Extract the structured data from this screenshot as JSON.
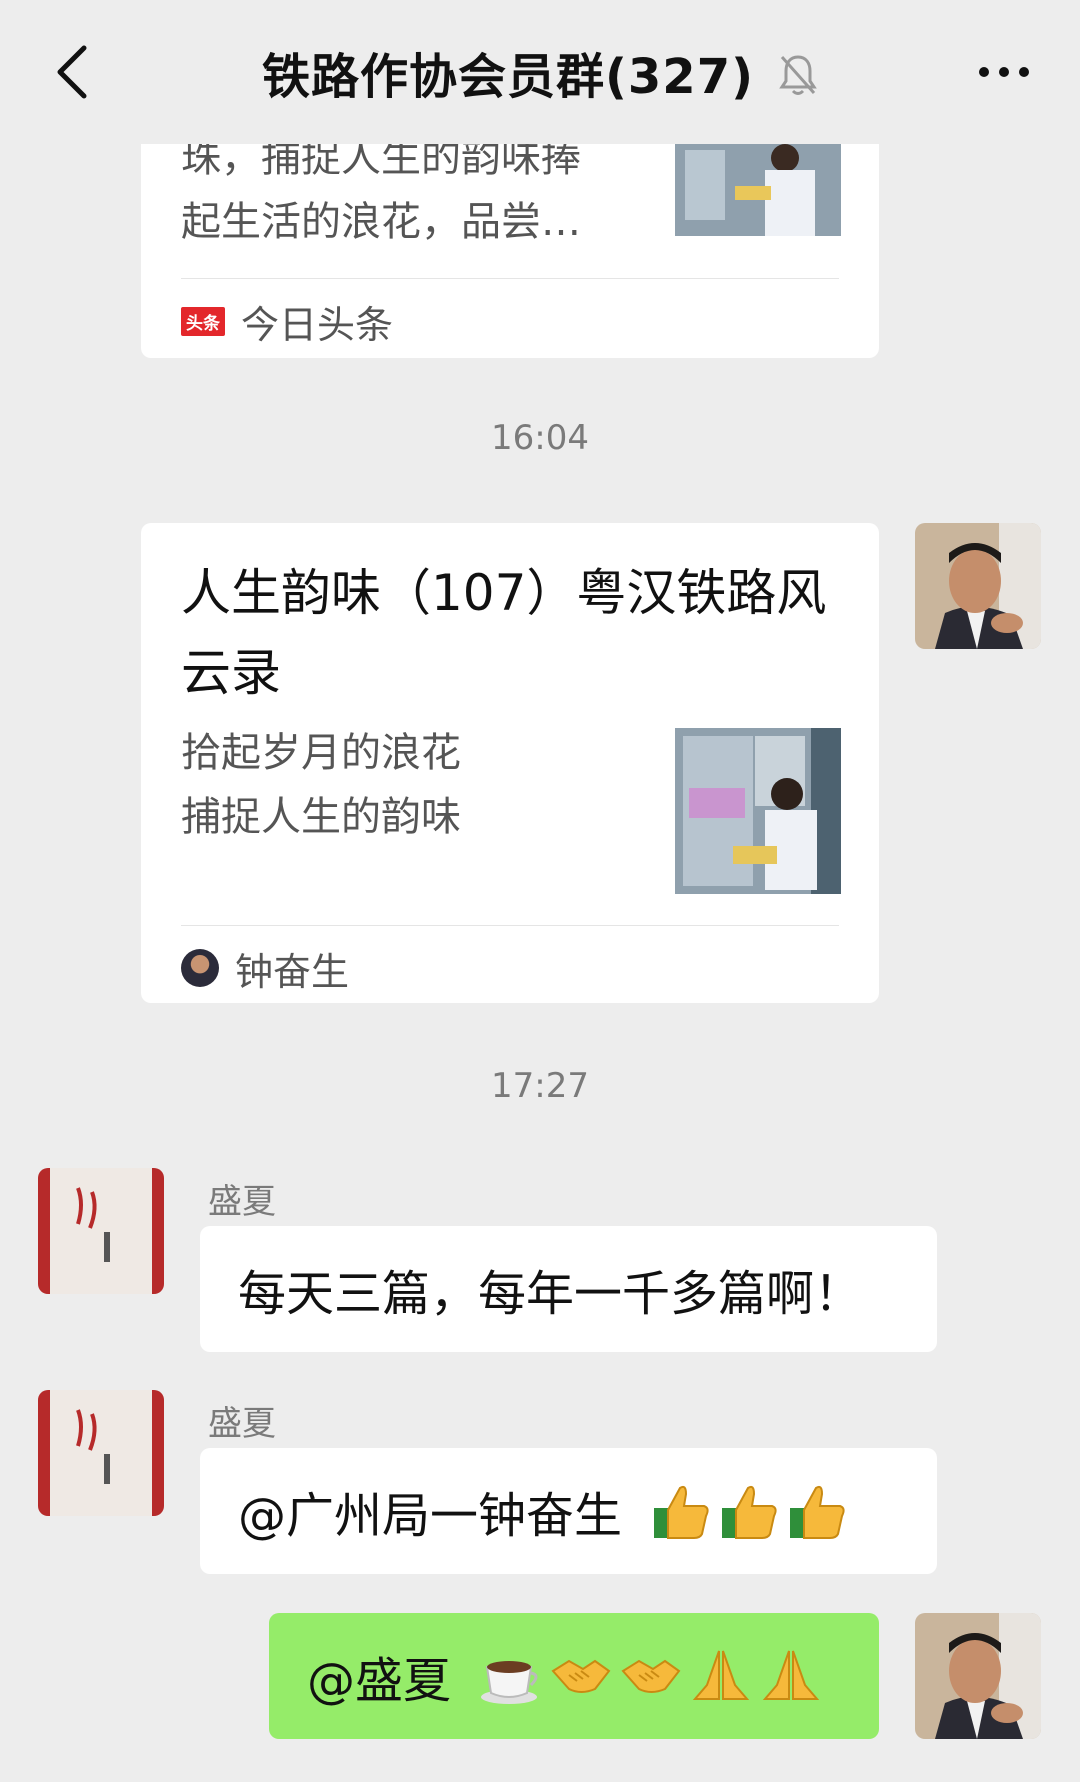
{
  "header": {
    "title": "铁路作协会员群(327)",
    "back_icon": "chevron-left-icon",
    "mute_icon": "bell-off-icon",
    "more_icon": "more-dots-icon"
  },
  "card1": {
    "line1": "珠，捕捉人生的韵味捧",
    "line2": "起生活的浪花，品尝…",
    "source_badge": "头条",
    "source": "今日头条"
  },
  "time1": "16:04",
  "card2": {
    "title_line1": "人生韵味（107）粤汉铁路风",
    "title_line2": "云录",
    "desc_line1": "拾起岁月的浪花",
    "desc_line2": "捕捉人生的韵味",
    "source": "钟奋生"
  },
  "time2": "17:27",
  "messages": [
    {
      "sender": "盛夏",
      "text": "每天三篇，每年一千多篇啊！"
    },
    {
      "sender": "盛夏",
      "text": "@广州局一钟奋生",
      "emojis": [
        "thumbs-up-icon",
        "thumbs-up-icon",
        "thumbs-up-icon"
      ]
    },
    {
      "sender": "",
      "text": "@盛夏",
      "emojis": [
        "coffee-icon",
        "handshake-icon",
        "handshake-icon",
        "pray-icon",
        "pray-icon"
      ]
    }
  ],
  "colors": {
    "background": "#ededed",
    "self_bubble": "#95ec69",
    "toutiao_red": "#e3272b"
  }
}
